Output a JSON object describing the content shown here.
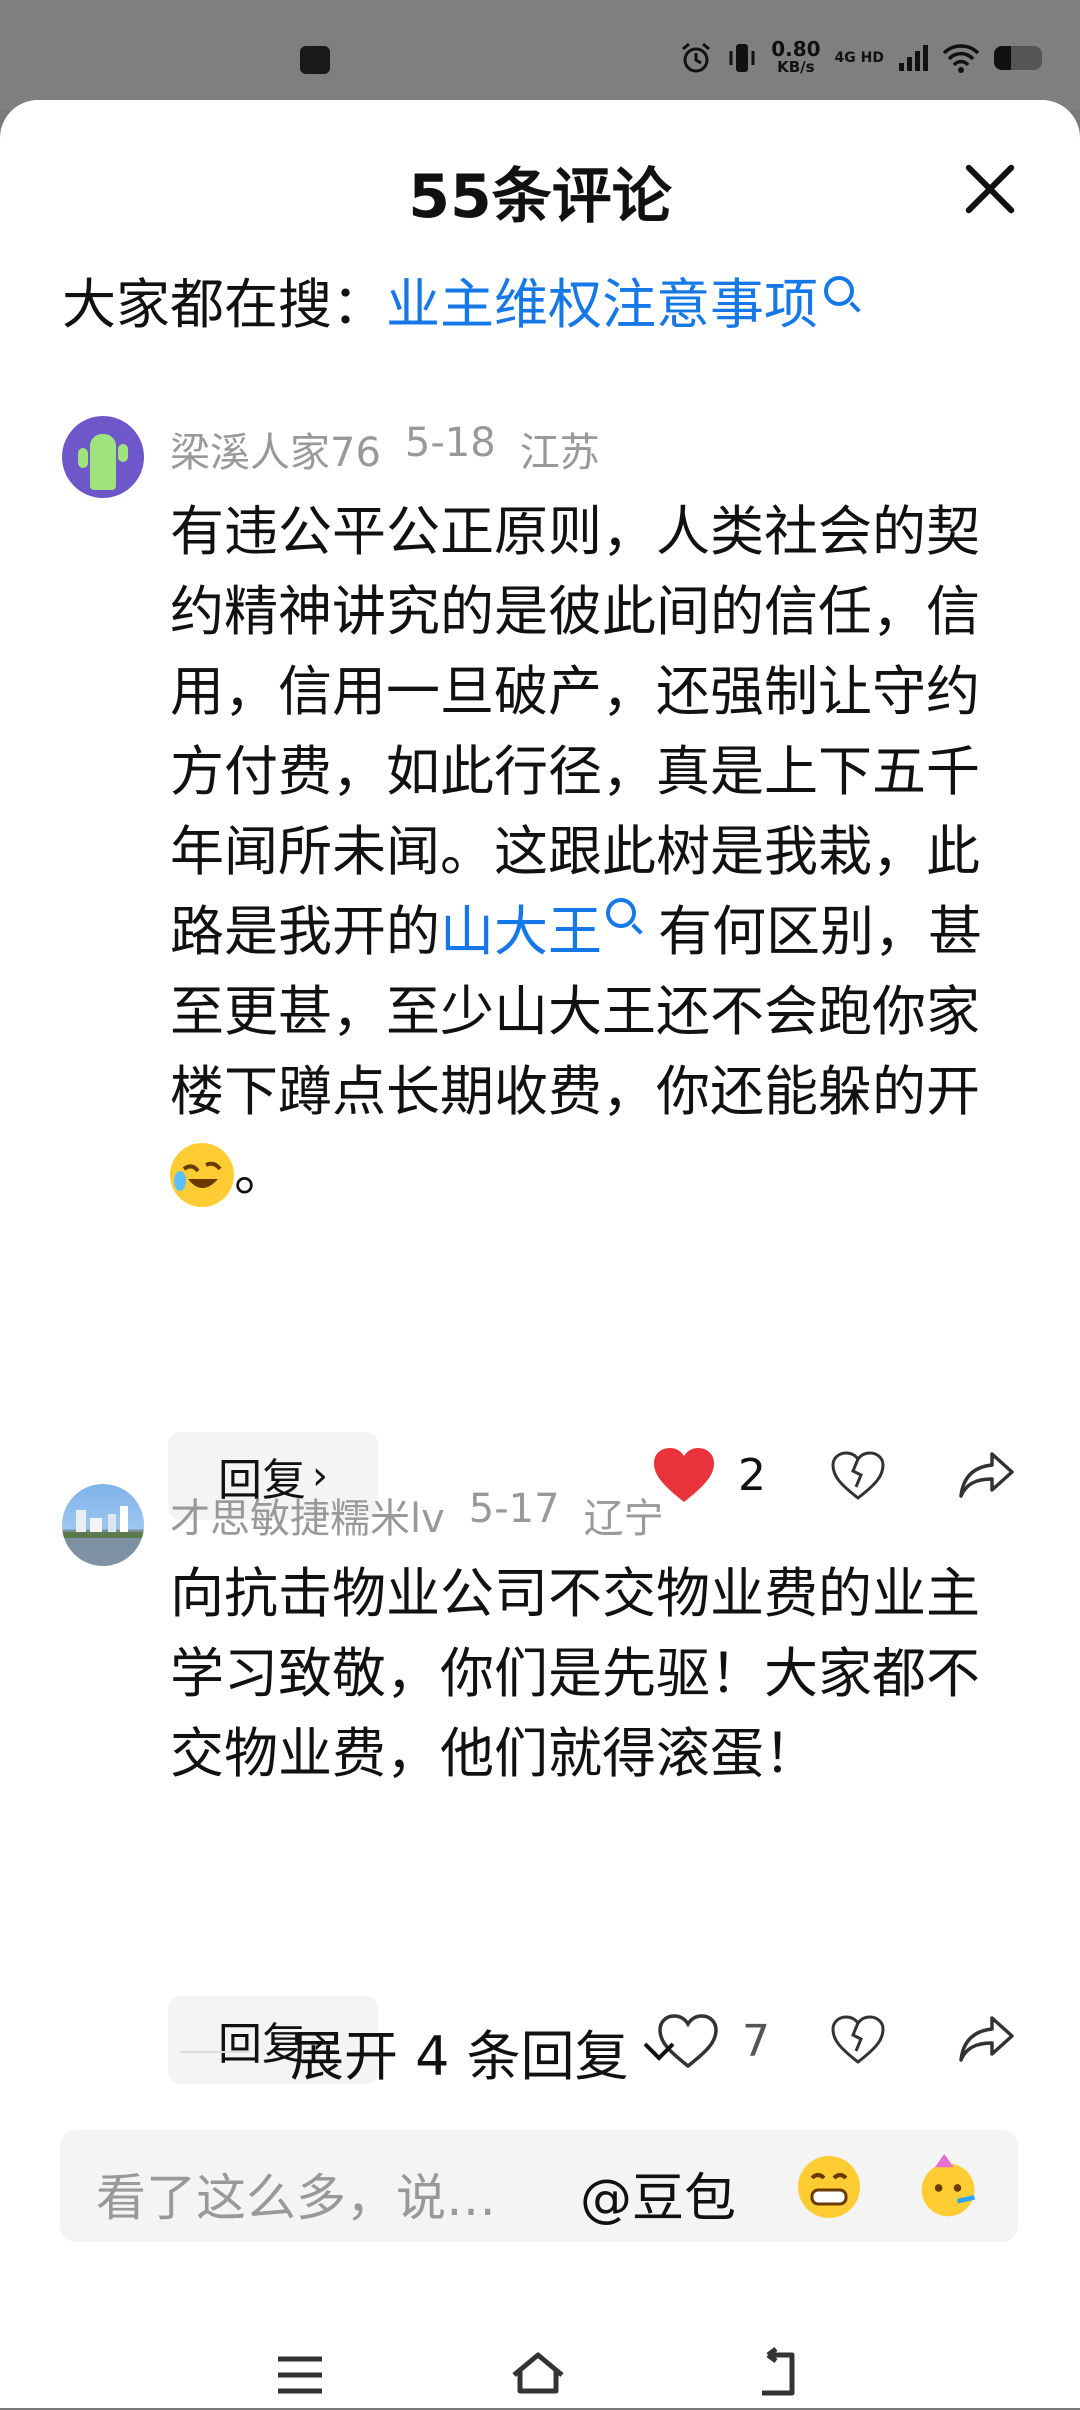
{
  "statusbar": {
    "net_speed": "0.80",
    "net_speed_unit": "KB/s",
    "network_type": "4G HD",
    "battery_level": 0.35,
    "icons": [
      "notification-icon",
      "alarm-icon",
      "vibrate-icon",
      "signal-icon",
      "wifi-icon",
      "battery-icon"
    ]
  },
  "header": {
    "title": "55条评论"
  },
  "search": {
    "prefix": "大家都在搜：",
    "query": "业主维权注意事项"
  },
  "comments": [
    {
      "user": "梁溪人家76",
      "date": "5-18",
      "location": "江苏",
      "text_part1": "有违公平公正原则，人类社会的契约精神讲究的是彼此间的信任，信用，信用一旦破产，还强制让守约方付费，如此行径，真是上下五千年闻所未闻。这跟此树是我栽，此路是我开的",
      "link": "山大王",
      "text_part2": "有何区别，甚至更甚，至少山大王还不会跑你家楼下蹲点长期收费，你还能躲的开",
      "text_end": "。",
      "emoji": "rolling-on-floor-laughing-emoji",
      "reply_label": "回复",
      "likes": "2",
      "liked": true
    },
    {
      "user": "才思敏捷糯米lv",
      "date": "5-17",
      "location": "辽宁",
      "text": "向抗击物业公司不交物业费的业主学习致敬，你们是先驱！大家都不交物业费，他们就得滚蛋！",
      "reply_label": "回复",
      "likes": "7",
      "liked": false
    }
  ],
  "expand": {
    "label": "展开 4 条回复"
  },
  "input": {
    "placeholder": "看了这么多，说…",
    "mention": "@豆包"
  },
  "navbar": {
    "icons": [
      "menu-icon",
      "home-icon",
      "back-icon"
    ]
  },
  "colors": {
    "link": "#1677e6",
    "like_red": "#e8333a"
  }
}
